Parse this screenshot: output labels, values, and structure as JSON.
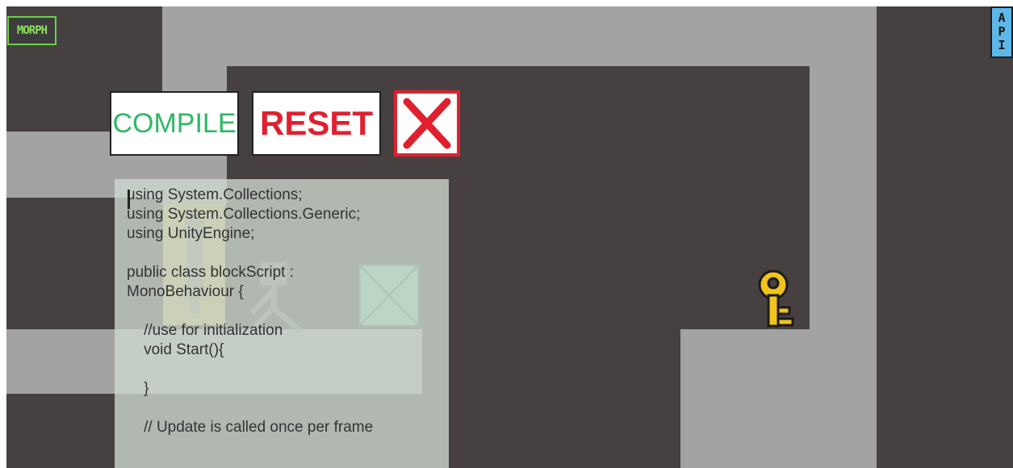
{
  "hud": {
    "morph_label": "MORPH",
    "api_label": [
      "A",
      "P",
      "I"
    ]
  },
  "toolbar": {
    "compile_label": "COMPILE",
    "reset_label": "RESET",
    "close_icon": "close-x-icon"
  },
  "editor": {
    "lines": [
      "using System.Collections;",
      "using System.Collections.Generic;",
      "using UnityEngine;",
      "",
      "public class blockScript :",
      "MonoBehaviour {",
      "",
      "    //use for initialization",
      "    void Start(){",
      "",
      "    }",
      "",
      "    // Update is called once per frame"
    ]
  },
  "sprites": {
    "player_icon": "player-robot-icon",
    "figure_icon": "stick-figure-icon",
    "box_icon": "crate-icon",
    "key_icon": "key-icon"
  },
  "colors": {
    "floor": "#474040",
    "wall": "#a3a3a3",
    "compile": "#2fb865",
    "reset": "#e0202e",
    "key": "#f2c31b",
    "morph": "#8de05f",
    "api_bg": "#5cb8e8"
  }
}
